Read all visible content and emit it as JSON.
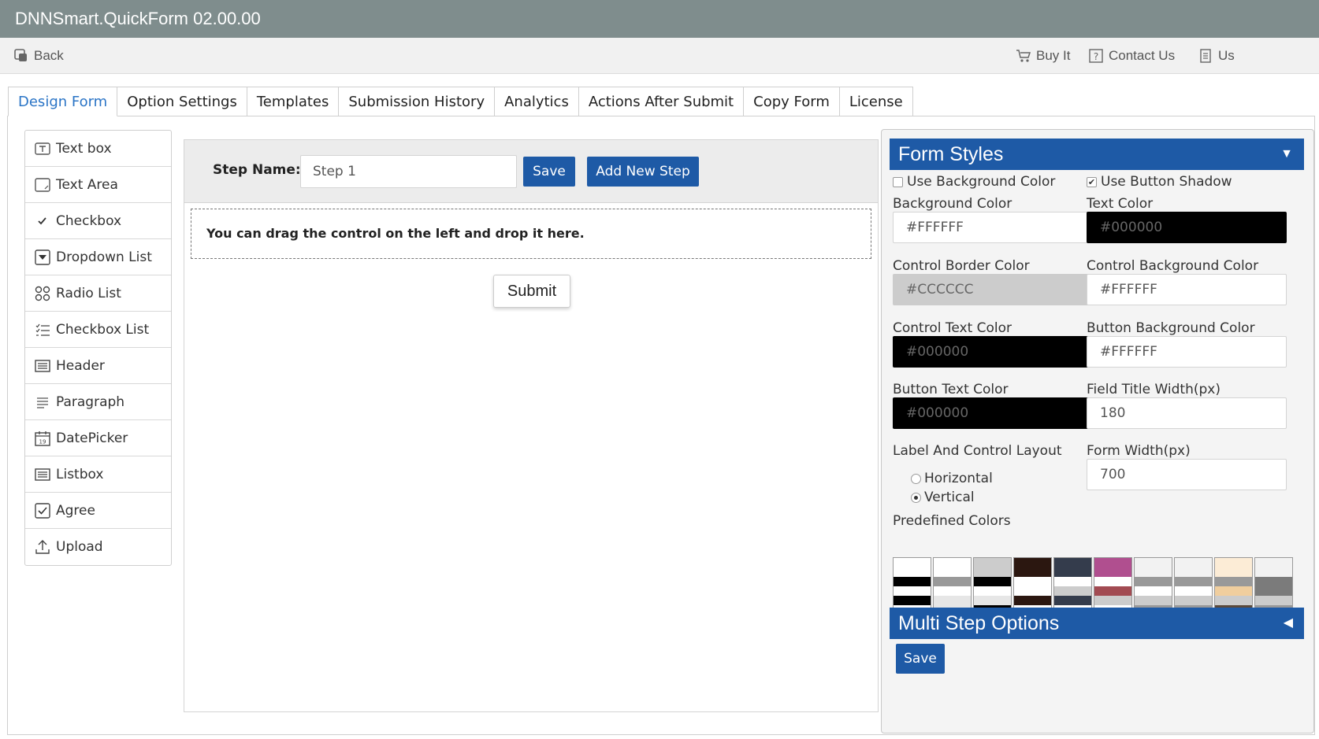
{
  "app": {
    "title": "DNNSmart.QuickForm 02.00.00"
  },
  "toolbar": {
    "back_label": "Back",
    "buy_label": "Buy It",
    "contact_label": "Contact Us",
    "user_manual_label": "Us"
  },
  "tabs": [
    {
      "label": "Design Form",
      "active": true
    },
    {
      "label": "Option Settings"
    },
    {
      "label": "Templates"
    },
    {
      "label": "Submission History"
    },
    {
      "label": "Analytics"
    },
    {
      "label": "Actions After Submit"
    },
    {
      "label": "Copy Form"
    },
    {
      "label": "License"
    }
  ],
  "palette": {
    "items": [
      {
        "label": "Text box",
        "icon": "textbox-icon"
      },
      {
        "label": "Text Area",
        "icon": "textarea-icon"
      },
      {
        "label": "Checkbox",
        "icon": "check-icon"
      },
      {
        "label": "Dropdown List",
        "icon": "dropdown-icon"
      },
      {
        "label": "Radio List",
        "icon": "radio-list-icon"
      },
      {
        "label": "Checkbox List",
        "icon": "checkbox-list-icon"
      },
      {
        "label": "Header",
        "icon": "header-icon"
      },
      {
        "label": "Paragraph",
        "icon": "paragraph-icon"
      },
      {
        "label": "DatePicker",
        "icon": "calendar-icon"
      },
      {
        "label": "Listbox",
        "icon": "listbox-icon"
      },
      {
        "label": "Agree",
        "icon": "agree-icon"
      },
      {
        "label": "Upload",
        "icon": "upload-icon"
      }
    ]
  },
  "designer": {
    "step_name_label": "Step Name:",
    "step_name_value": "Step 1",
    "save_label": "Save",
    "add_step_label": "Add New Step",
    "drop_hint": "You can drag the control on the left and drop it here.",
    "submit_label": "Submit"
  },
  "form_styles": {
    "title": "Form Styles",
    "use_bg_color_label": "Use Background Color",
    "use_bg_color_checked": false,
    "use_btn_shadow_label": "Use Button Shadow",
    "use_btn_shadow_checked": true,
    "bg_color_label": "Background Color",
    "bg_color_value": "#FFFFFF",
    "text_color_label": "Text Color",
    "text_color_value": "#000000",
    "ctrl_border_label": "Control Border Color",
    "ctrl_border_value": "#CCCCCC",
    "ctrl_bg_label": "Control Background Color",
    "ctrl_bg_value": "#FFFFFF",
    "ctrl_text_label": "Control Text Color",
    "ctrl_text_value": "#000000",
    "btn_bg_label": "Button Background Color",
    "btn_bg_value": "#FFFFFF",
    "btn_text_label": "Button Text Color",
    "btn_text_value": "#000000",
    "title_width_label": "Field Title Width(px)",
    "title_width_value": "180",
    "layout_label": "Label And Control Layout",
    "layout_horizontal": "Horizontal",
    "layout_vertical": "Vertical",
    "layout_selected": "Vertical",
    "form_width_label": "Form Width(px)",
    "form_width_value": "700",
    "predefined_label": "Predefined Colors",
    "predefined": [
      [
        "#ffffff",
        "#ffffff",
        "#000000",
        "#ffffff",
        "#000000",
        "#ffffff",
        "#000000",
        "#ffffff"
      ],
      [
        "#ffffff",
        "#ffffff",
        "#999999",
        "#ffffff",
        "#e6e6e6",
        "#e6e6e6",
        "#999999",
        "#ffffff"
      ],
      [
        "#cccccc",
        "#cccccc",
        "#000000",
        "#ffffff",
        "#e6e6e6",
        "#000000",
        "#e8b222",
        "#ffffff"
      ],
      [
        "#2b1710",
        "#2b1710",
        "#ffffff",
        "#ffffff",
        "#2b1710",
        "#ffffff",
        "#e8611a",
        "#ffffff"
      ],
      [
        "#343c4c",
        "#343c4c",
        "#ffffff",
        "#cccccc",
        "#343c4c",
        "#ffffff",
        "#8fb15d",
        "#ffffff"
      ],
      [
        "#b04f8f",
        "#b04f8f",
        "#ffffff",
        "#a24b52",
        "#cccccc",
        "#ffffff",
        "#a21fa4",
        "#ffffff"
      ],
      [
        "#f2f2f2",
        "#f2f2f2",
        "#999999",
        "#ffffff",
        "#cccccc",
        "#999999",
        "#e94e83",
        "#ffffff"
      ],
      [
        "#f2f2f2",
        "#f2f2f2",
        "#999999",
        "#ffffff",
        "#cccccc",
        "#999999",
        "#f15a1d",
        "#ffffff"
      ],
      [
        "#fcecd6",
        "#fcecd6",
        "#999999",
        "#f0ce9e",
        "#cccccc",
        "#5b4a3c",
        "#e4b88a",
        "#ffffff"
      ],
      [
        "#f2f2f2",
        "#f2f2f2",
        "#7b7b7b",
        "#7b7b7b",
        "#cccccc",
        "#999999",
        "#2d79c5",
        "#ffffff"
      ]
    ]
  },
  "multi_step": {
    "title": "Multi Step Options"
  },
  "panel_save_label": "Save",
  "colors": {
    "brand_blue": "#1e5aa6",
    "title_bar": "#7f8d8d",
    "active_tab": "#2a74c6"
  }
}
